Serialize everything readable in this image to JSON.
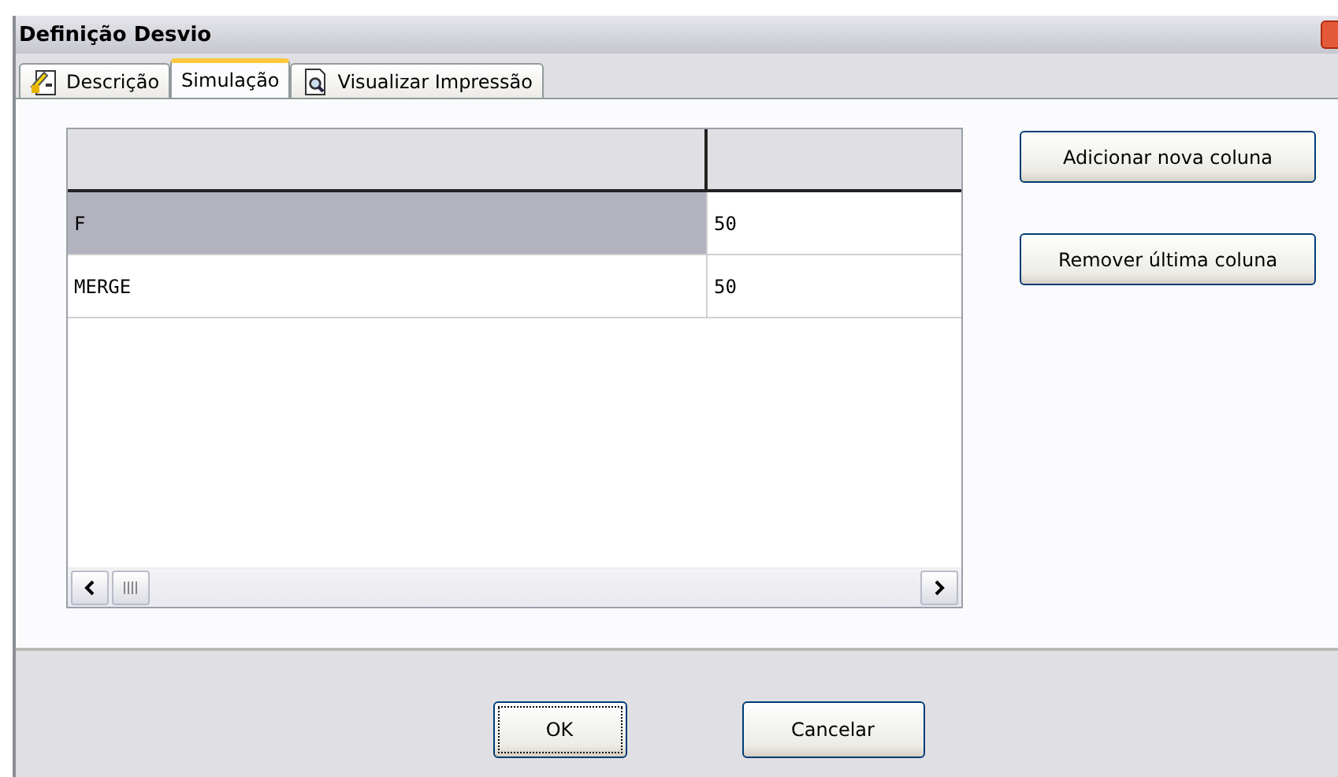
{
  "window": {
    "title": "Definição Desvio"
  },
  "tabs": [
    {
      "label": "Descrição",
      "kind": "document",
      "selected": false
    },
    {
      "label": "Simulação",
      "selected": true
    },
    {
      "label": "Visualizar Impressão",
      "kind": "preview",
      "selected": false
    }
  ],
  "grid": {
    "rows": [
      {
        "cells": [
          "F",
          "50"
        ],
        "selected": true
      },
      {
        "cells": [
          "MERGE",
          "50"
        ],
        "selected": false
      }
    ]
  },
  "side_buttons": [
    "Adicionar nova coluna",
    "Remover última coluna"
  ],
  "buttons": [
    {
      "label": "OK",
      "focused": true
    },
    {
      "label": "Cancelar",
      "focused": false
    }
  ]
}
